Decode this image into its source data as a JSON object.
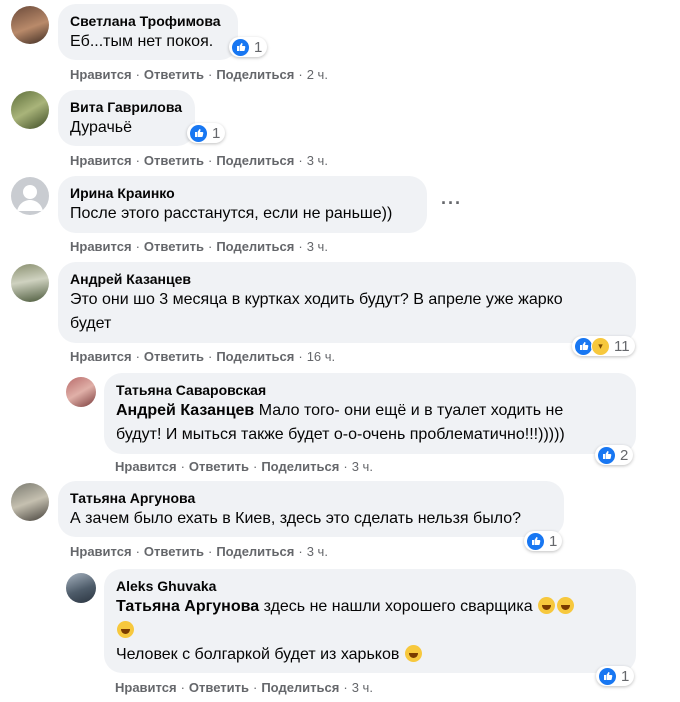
{
  "actions": {
    "like": "Нравится",
    "reply": "Ответить",
    "share": "Поделиться",
    "sep": "·"
  },
  "comments": [
    {
      "author": "Светлана Трофимова",
      "text": "Еб...тым нет покоя.",
      "time": "2 ч.",
      "reactions": "1"
    },
    {
      "author": "Вита Гаврилова",
      "text": "Дурачьё",
      "time": "3 ч.",
      "reactions": "1"
    },
    {
      "author": "Ирина Краинко",
      "text": "После этого расстанутся, если не раньше))",
      "time": "3 ч.",
      "more": "···"
    },
    {
      "author": "Андрей Казанцев",
      "text_line1": "Это они шо 3 месяца в куртках ходить будут? В апреле уже жарко",
      "text_line2": "будет",
      "time": "16 ч.",
      "reactions": "11"
    },
    {
      "author": "Татьяна Саваровская",
      "mention": "Андрей Казанцев",
      "text_line1": " Мало того- они ещё и в туалет ходить не",
      "text_line2": "будут! И мыться также будет о-о-очень проблематично!!!)))))",
      "time": "3 ч.",
      "reactions": "2"
    },
    {
      "author": "Татьяна Аргунова",
      "text": "А зачем было ехать в Киев, здесь это сделать нельзя было?",
      "time": "3 ч.",
      "reactions": "1"
    },
    {
      "author": "Aleks Ghuvaka",
      "mention": "Татьяна Аргунова",
      "text_line1": " здесь не нашли хорошего сварщика",
      "text_line3": "Человек с болгаркой будет из харьков",
      "time": "3 ч.",
      "reactions": "1"
    }
  ],
  "colors": {
    "like_blue": "#1877f2",
    "bubble": "#f0f2f5",
    "meta": "#65676b"
  }
}
